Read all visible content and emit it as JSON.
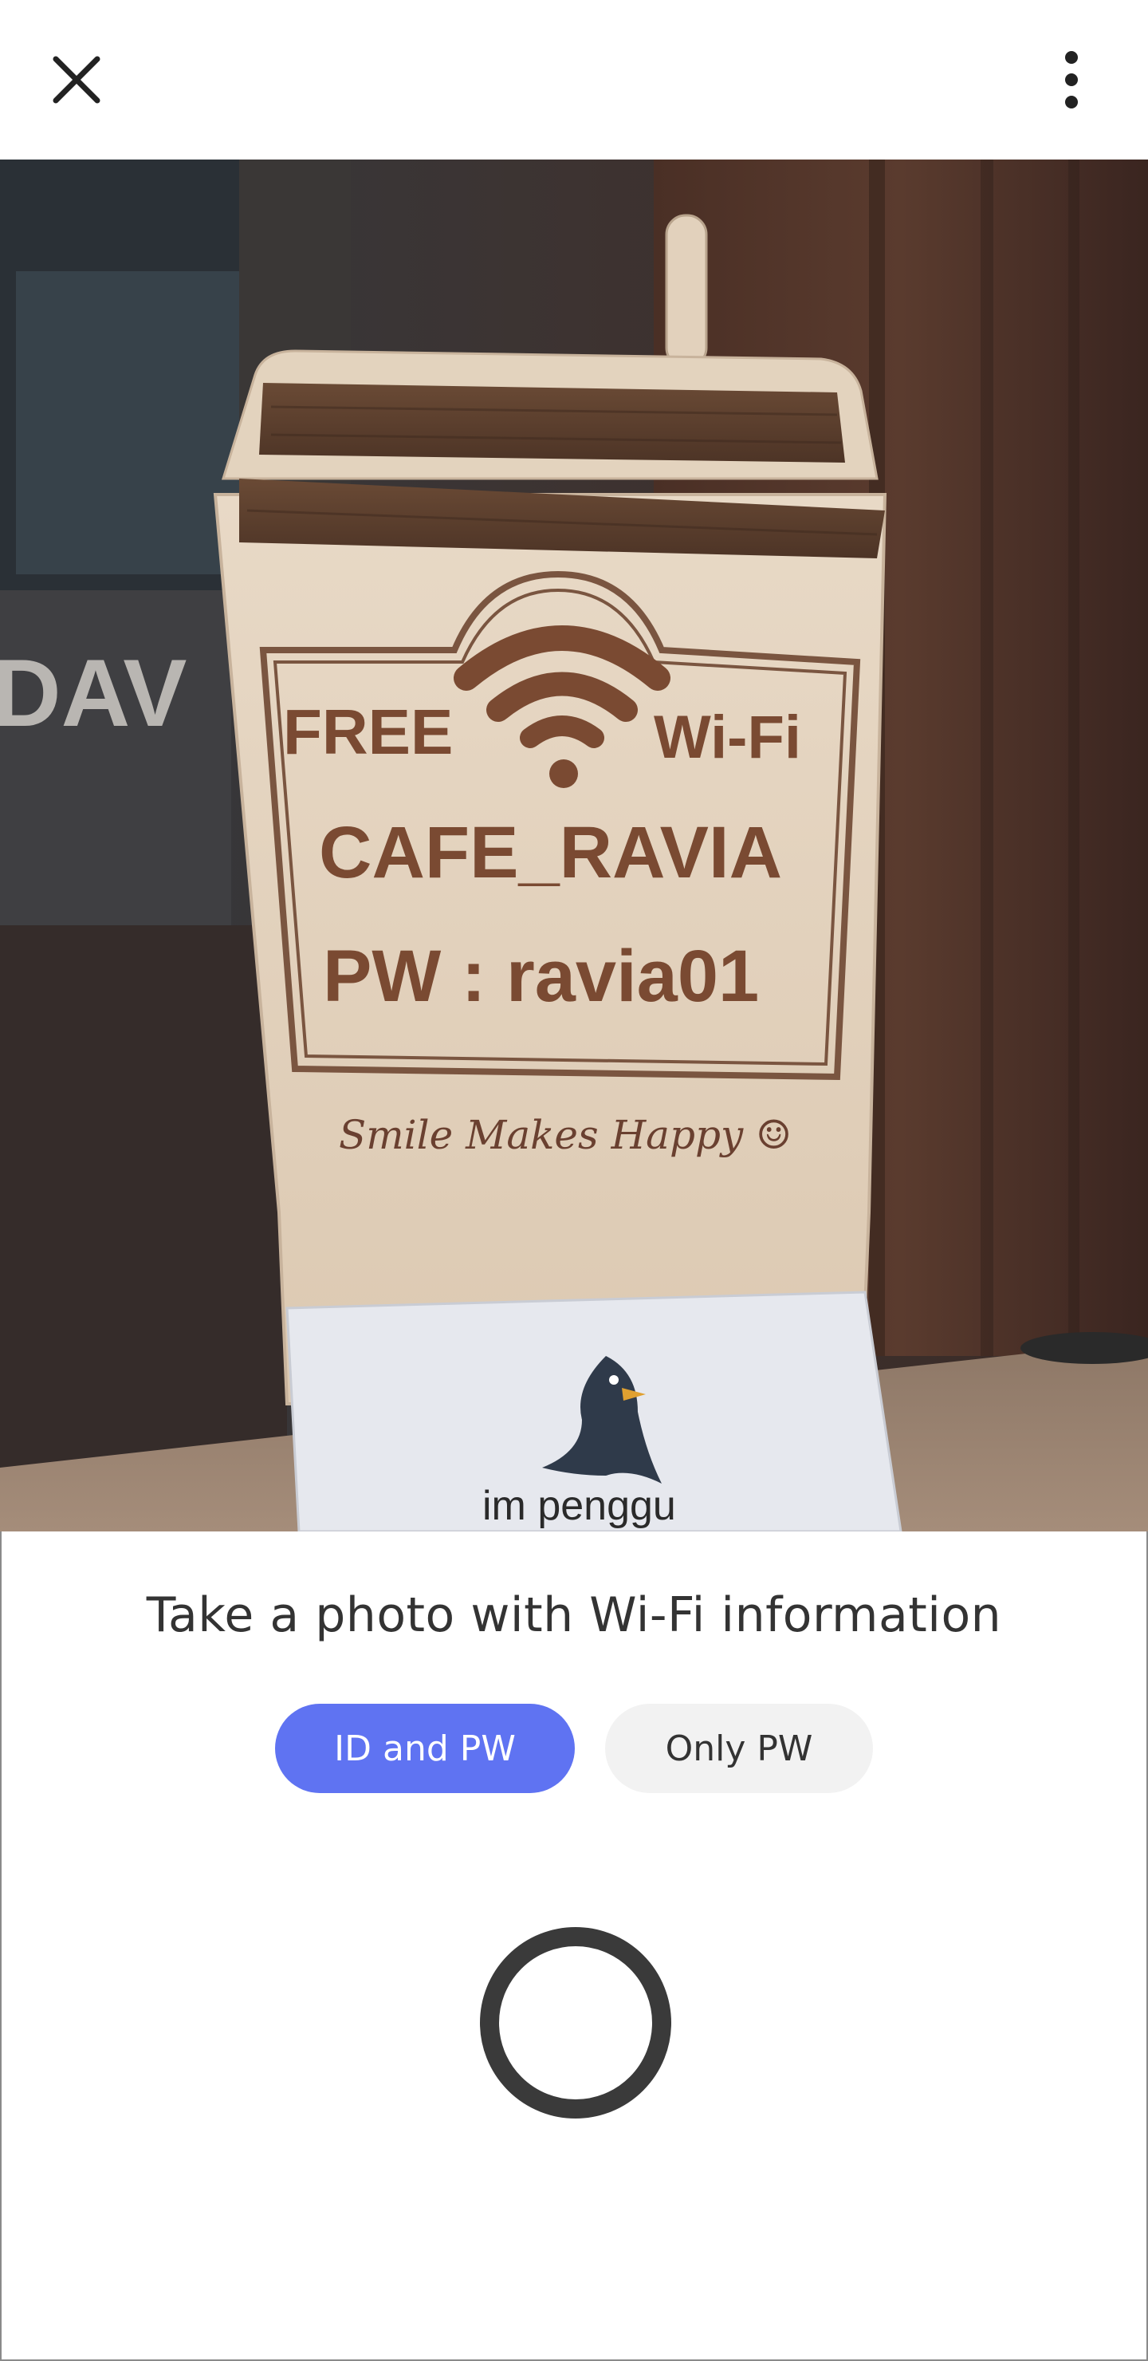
{
  "header": {
    "close_icon": "close-icon",
    "more_icon": "more-vertical-icon"
  },
  "preview": {
    "sign_free": "FREE",
    "sign_wifi": "Wi-Fi",
    "sign_ssid": "CAFE_RAVIA",
    "sign_pw": "PW : ravia01",
    "sign_slogan": "Smile Makes Happy ☺",
    "card_text": "im penggu",
    "background_text": "DAV"
  },
  "panel": {
    "instruction": "Take a photo with Wi-Fi information",
    "modes": [
      {
        "label": "ID and PW",
        "selected": true
      },
      {
        "label": "Only PW",
        "selected": false
      }
    ],
    "shutter_icon": "shutter-button-icon"
  },
  "colors": {
    "accent": "#5f73f2",
    "inactive_pill": "#f2f2f2",
    "text": "#333333"
  }
}
